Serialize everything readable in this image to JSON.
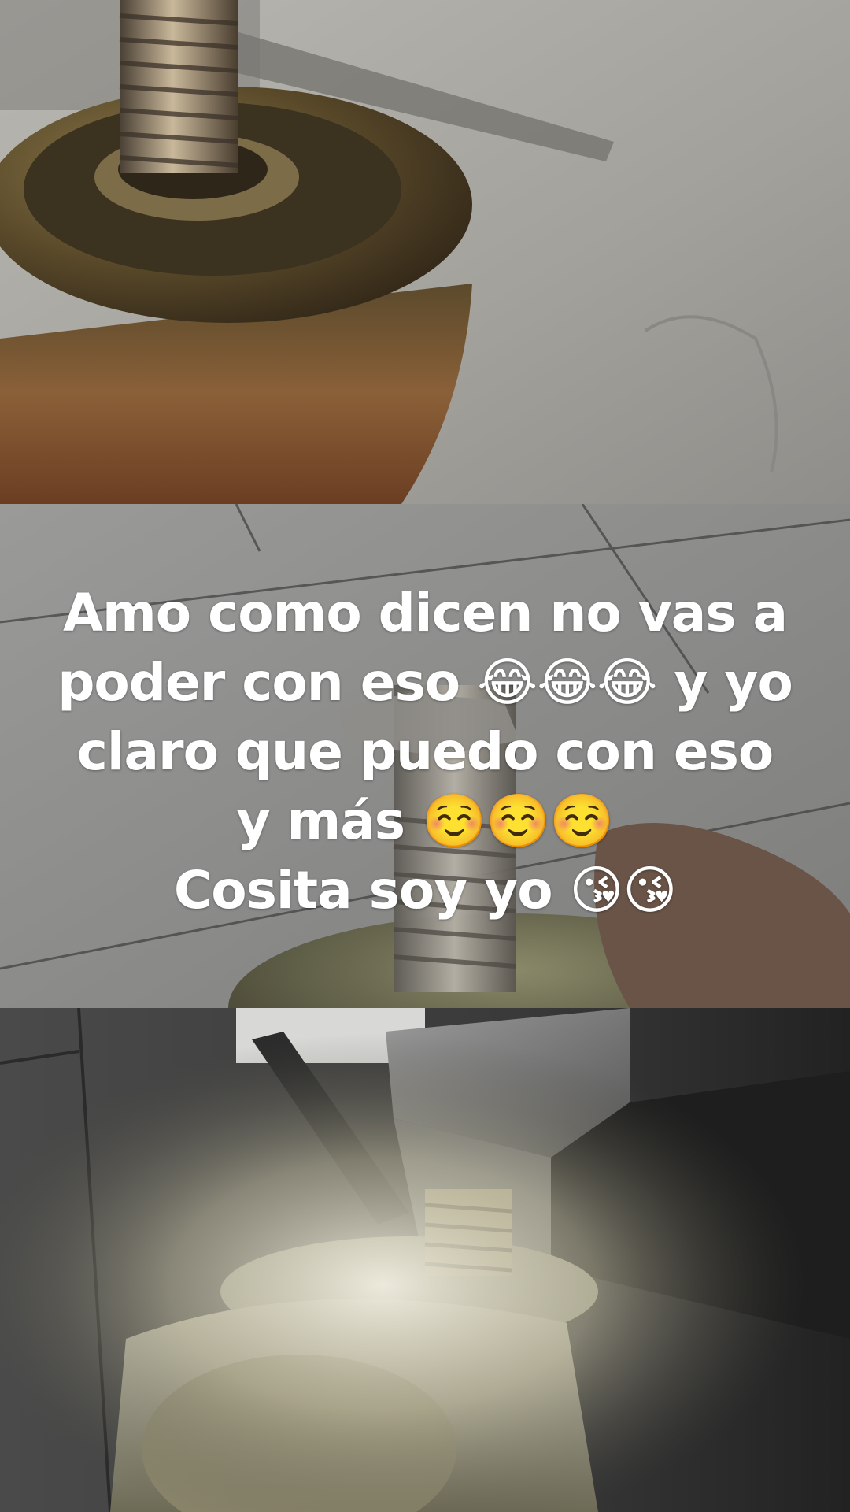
{
  "overlay": {
    "caption": "Amo como dicen no vas a poder con eso 😂😂😂 y yo claro que puedo con eso y más ☺️☺️☺️\nCosita soy yo 😘😘"
  },
  "panels": [
    {
      "subject": "metal caster stem with threaded bolt on concrete"
    },
    {
      "subject": "threaded bolt close-up on tiled floor"
    },
    {
      "subject": "caster bolt inserted into metal bracket"
    }
  ]
}
